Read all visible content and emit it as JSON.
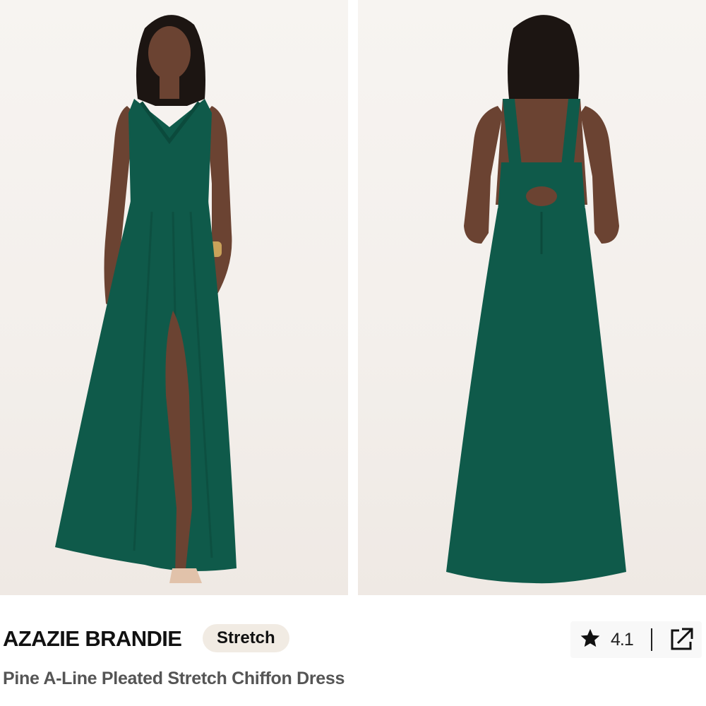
{
  "product": {
    "brand": "AZAZIE BRANDIE",
    "badge": "Stretch",
    "subtitle": "Pine A-Line Pleated Stretch Chiffon Dress",
    "rating": "4.1",
    "dress_color": "#0f5a4a"
  },
  "icons": {
    "rating": "star-icon",
    "share": "external-link-icon"
  }
}
